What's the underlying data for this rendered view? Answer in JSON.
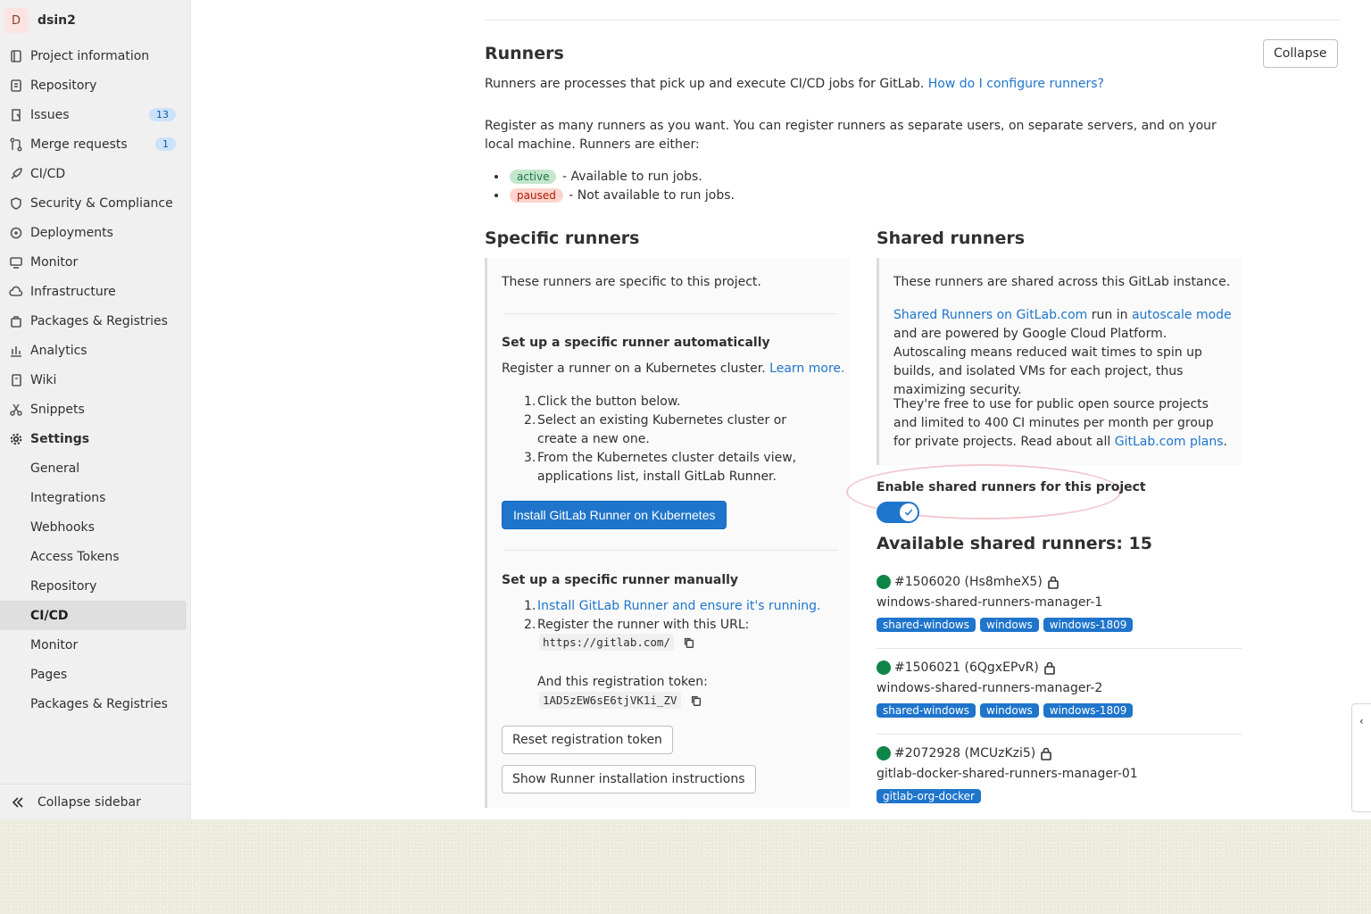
{
  "project": {
    "avatar_letter": "D",
    "name": "dsin2"
  },
  "sidebar": {
    "items": [
      {
        "label": "Project information",
        "icon": "project-info-icon"
      },
      {
        "label": "Repository",
        "icon": "repository-icon"
      },
      {
        "label": "Issues",
        "icon": "issues-icon",
        "count": "13"
      },
      {
        "label": "Merge requests",
        "icon": "merge-request-icon",
        "count": "1"
      },
      {
        "label": "CI/CD",
        "icon": "rocket-icon"
      },
      {
        "label": "Security & Compliance",
        "icon": "shield-icon"
      },
      {
        "label": "Deployments",
        "icon": "deployments-icon"
      },
      {
        "label": "Monitor",
        "icon": "monitor-icon"
      },
      {
        "label": "Infrastructure",
        "icon": "cloud-icon"
      },
      {
        "label": "Packages & Registries",
        "icon": "package-icon"
      },
      {
        "label": "Analytics",
        "icon": "chart-icon"
      },
      {
        "label": "Wiki",
        "icon": "book-icon"
      },
      {
        "label": "Snippets",
        "icon": "scissors-icon"
      },
      {
        "label": "Settings",
        "icon": "gear-icon"
      }
    ],
    "settings_sub": [
      "General",
      "Integrations",
      "Webhooks",
      "Access Tokens",
      "Repository",
      "CI/CD",
      "Monitor",
      "Pages",
      "Packages & Registries"
    ],
    "active_sub": "CI/CD",
    "collapse_label": "Collapse sidebar"
  },
  "runners": {
    "title": "Runners",
    "collapse_button": "Collapse",
    "intro": "Runners are processes that pick up and execute CI/CD jobs for GitLab.",
    "intro_link": "How do I configure runners?",
    "register_text": "Register as many runners as you want. You can register runners as separate users, on separate servers, and on your local machine. Runners are either:",
    "states": [
      {
        "badge": "active",
        "desc": "- Available to run jobs."
      },
      {
        "badge": "paused",
        "desc": "- Not available to run jobs."
      }
    ]
  },
  "specific": {
    "title": "Specific runners",
    "intro": "These runners are specific to this project.",
    "auto_title": "Set up a specific runner automatically",
    "auto_text": "Register a runner on a Kubernetes cluster.",
    "auto_link": "Learn more.",
    "auto_steps": [
      "Click the button below.",
      "Select an existing Kubernetes cluster or create a new one.",
      "From the Kubernetes cluster details view, applications list, install GitLab Runner."
    ],
    "install_button": "Install GitLab Runner on Kubernetes",
    "manual_title": "Set up a specific runner manually",
    "manual_step1": "Install GitLab Runner and ensure it's running.",
    "manual_step2": "Register the runner with this URL:",
    "url": "https://gitlab.com/",
    "token_label": "And this registration token:",
    "token": "1AD5zEW6sE6tjVK1i_ZV",
    "reset_button": "Reset registration token",
    "show_button": "Show Runner installation instructions"
  },
  "shared": {
    "title": "Shared runners",
    "intro": "These runners are shared across this GitLab instance.",
    "p2_link1": "Shared Runners on GitLab.com",
    "p2_mid": "run in",
    "p2_link2": "autoscale mode",
    "p2_rest": "and are powered by Google Cloud Platform. Autoscaling means reduced wait times to spin up builds, and isolated VMs for each project, thus maximizing security.",
    "p3": "They're free to use for public open source projects and limited to 400 CI minutes per month per group for private projects. Read about all",
    "p3_link": "GitLab.com plans",
    "toggle_label": "Enable shared runners for this project",
    "toggle_on": true,
    "available_title": "Available shared runners: 15",
    "list": [
      {
        "id": "#1506020 (Hs8mheX5)",
        "name": "windows-shared-runners-manager-1",
        "tags": [
          "shared-windows",
          "windows",
          "windows-1809"
        ]
      },
      {
        "id": "#1506021 (6QgxEPvR)",
        "name": "windows-shared-runners-manager-2",
        "tags": [
          "shared-windows",
          "windows",
          "windows-1809"
        ]
      },
      {
        "id": "#2072928 (MCUzKzi5)",
        "name": "gitlab-docker-shared-runners-manager-01",
        "tags": [
          "gitlab-org-docker"
        ]
      }
    ]
  },
  "colors": {
    "accent": "#1f75cb",
    "online": "#108548",
    "sidebar_bg": "#f0f0f0"
  }
}
